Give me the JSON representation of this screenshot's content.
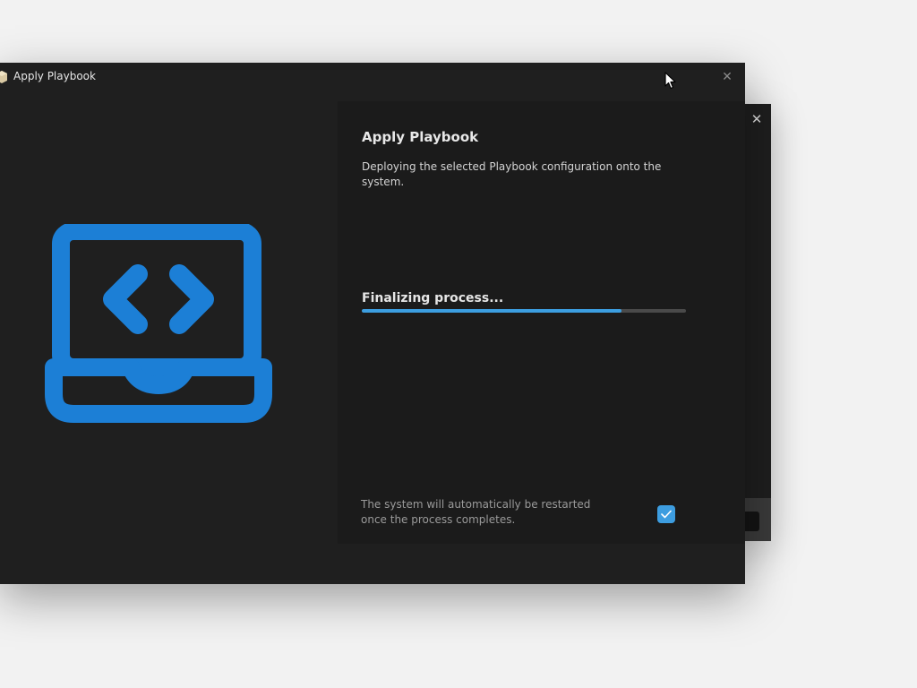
{
  "window": {
    "title": "Apply Playbook",
    "close_glyph": "✕"
  },
  "background_window": {
    "close_glyph": "✕"
  },
  "content": {
    "heading": "Apply Playbook",
    "description": "Deploying the selected Playbook configuration onto the system."
  },
  "progress": {
    "label": "Finalizing process...",
    "fraction": 0.8
  },
  "restart_option": {
    "text": "The system will automatically be restarted once the process completes.",
    "checked": true
  },
  "icons": {
    "app": "playbook-app-icon",
    "hero": "laptop-code-icon",
    "close": "close-icon",
    "check": "checkmark-icon",
    "cursor": "mouse-pointer-icon"
  },
  "colors": {
    "accent": "#3c9ee0",
    "hero_icon": "#1c7fd6",
    "window_bg": "#1f1f1f",
    "panel_bg": "#1b1b1b",
    "desktop_bg": "#f2f2f2"
  }
}
